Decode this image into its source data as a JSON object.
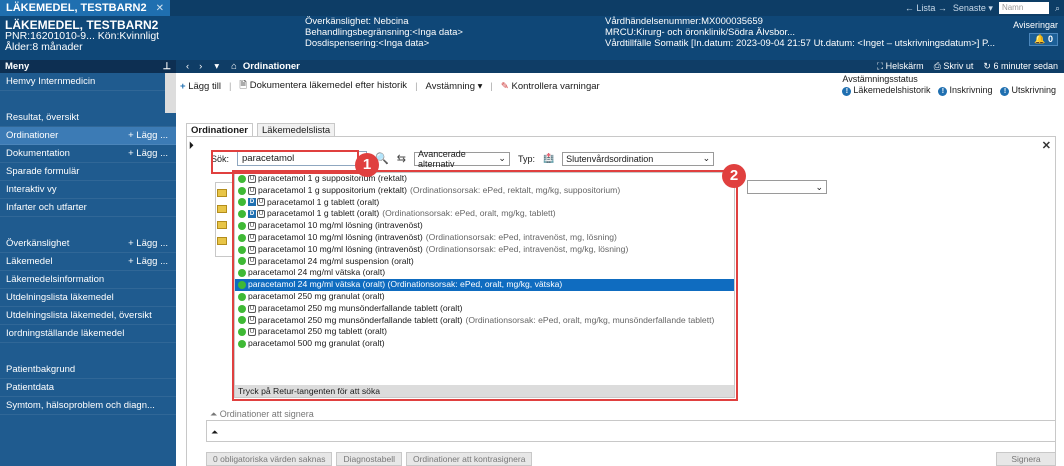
{
  "patient": {
    "tab_name": "LÄKEMEDEL, TESTBARN2",
    "name": "LÄKEMEDEL, TESTBARN2",
    "pnr_line": "PNR:16201010-9... Kön:Kvinnligt",
    "age_line": "Ålder:8 månader"
  },
  "header_info": {
    "col1": [
      "Överkänslighet: Nebcina",
      "Behandlingsbegränsning:<Inga data>",
      "Dosdispensering:<Inga data>"
    ],
    "col2": [
      "Vårdhändelsenummer:MX000035659",
      "MRCU:Kirurg- och öronklinik/Södra Älvsbor...",
      "Vårdtillfälle Somatik [In.datum: 2023-09-04 21:57 Ut.datum: <Inget – utskrivningsdatum>] P..."
    ]
  },
  "topbar": {
    "list": "← Lista →",
    "recent": "Senaste ▾",
    "search_placeholder": "Namn",
    "alerts_label": "Aviseringar",
    "alerts_count": "0"
  },
  "sidebar": {
    "header": "Meny",
    "items": [
      {
        "label": "Hemvy Internmedicin",
        "add": ""
      },
      {
        "label": "",
        "add": ""
      },
      {
        "label": "Resultat, översikt",
        "add": ""
      },
      {
        "label": "Ordinationer",
        "add": "+ Lägg ..."
      },
      {
        "label": "Dokumentation",
        "add": "+ Lägg ..."
      },
      {
        "label": "Sparade formulär",
        "add": ""
      },
      {
        "label": "Interaktiv vy",
        "add": ""
      },
      {
        "label": "Infarter och utfarter",
        "add": ""
      },
      {
        "label": "",
        "add": ""
      },
      {
        "label": "Överkänslighet",
        "add": "+ Lägg ..."
      },
      {
        "label": "Läkemedel",
        "add": "+ Lägg ..."
      },
      {
        "label": "Läkemedelsinformation",
        "add": ""
      },
      {
        "label": "Utdelningslista läkemedel",
        "add": ""
      },
      {
        "label": "Utdelningslista läkemedel, översikt",
        "add": ""
      },
      {
        "label": "Iordningställande läkemedel",
        "add": ""
      },
      {
        "label": "",
        "add": ""
      },
      {
        "label": "Patientbakgrund",
        "add": ""
      },
      {
        "label": "Patientdata",
        "add": ""
      },
      {
        "label": "Symtom, hälsoproblem och diagn...",
        "add": ""
      }
    ]
  },
  "navbar": {
    "title": "Ordinationer",
    "fullscreen": "Helskärm",
    "print": "Skriv ut",
    "updated": "6 minuter sedan"
  },
  "toolbar": {
    "add": "Lägg till",
    "document": "Dokumentera läkemedel efter historik",
    "reconcile": "Avstämning ▾",
    "check": "Kontrollera varningar"
  },
  "reconciliation": {
    "title": "Avstämningsstatus",
    "items": [
      "Läkemedelshistorik",
      "Inskrivning",
      "Utskrivning"
    ]
  },
  "tabs": [
    "Ordinationer",
    "Läkemedelslista"
  ],
  "search": {
    "label": "Sök:",
    "value": "paracetamol",
    "advanced": "Avancerade alternativ",
    "type_label": "Typ:",
    "type_value": "Slutenvårdsordination"
  },
  "results": [
    {
      "icons": "gu",
      "text": "paracetamol 1 g suppositorium (rektalt)",
      "extra": ""
    },
    {
      "icons": "gu",
      "text": "paracetamol 1 g suppositorium (rektalt)",
      "extra": "(Ordinationsorsak: ePed, rektalt, mg/kg, suppositorium)"
    },
    {
      "icons": "gdu",
      "text": "paracetamol 1 g tablett (oralt)",
      "extra": ""
    },
    {
      "icons": "gdu",
      "text": "paracetamol 1 g tablett (oralt)",
      "extra": "(Ordinationsorsak: ePed, oralt, mg/kg, tablett)"
    },
    {
      "icons": "gu",
      "text": "paracetamol 10 mg/ml lösning (intravenöst)",
      "extra": ""
    },
    {
      "icons": "gu",
      "text": "paracetamol 10 mg/ml lösning (intravenöst)",
      "extra": "(Ordinationsorsak: ePed, intravenöst, mg, lösning)"
    },
    {
      "icons": "gu",
      "text": "paracetamol 10 mg/ml lösning (intravenöst)",
      "extra": "(Ordinationsorsak: ePed, intravenöst, mg/kg, lösning)"
    },
    {
      "icons": "gu",
      "text": "paracetamol 24 mg/ml suspension (oralt)",
      "extra": ""
    },
    {
      "icons": "g",
      "text": "paracetamol 24 mg/ml vätska (oralt)",
      "extra": ""
    },
    {
      "icons": "g",
      "text": "paracetamol 24 mg/ml vätska (oralt) (Ordinationsorsak: ePed, oralt, mg/kg, vätska)",
      "extra": "",
      "selected": true
    },
    {
      "icons": "g",
      "text": "paracetamol 250 mg granulat (oralt)",
      "extra": ""
    },
    {
      "icons": "gu",
      "text": "paracetamol 250 mg munsönderfallande tablett (oralt)",
      "extra": ""
    },
    {
      "icons": "gu",
      "text": "paracetamol 250 mg munsönderfallande tablett (oralt)",
      "extra": "(Ordinationsorsak: ePed, oralt, mg/kg, munsönderfallande tablett)"
    },
    {
      "icons": "gu",
      "text": "paracetamol 250 mg tablett (oralt)",
      "extra": ""
    },
    {
      "icons": "g",
      "text": "paracetamol 500 mg granulat (oralt)",
      "extra": ""
    }
  ],
  "results_footer": "Tryck på Retur-tangenten för att söka",
  "callouts": [
    "1",
    "2"
  ],
  "bottom": {
    "to_sign": "Ordinationer att signera",
    "missing": "0 obligatoriska värden saknas",
    "diag": "Diagnostabell",
    "countersign": "Ordinationer att kontrasignera",
    "sign": "Signera"
  },
  "colors": {
    "accent": "#0f6cc0",
    "annotation": "#e0403f",
    "header": "#0f4777"
  }
}
